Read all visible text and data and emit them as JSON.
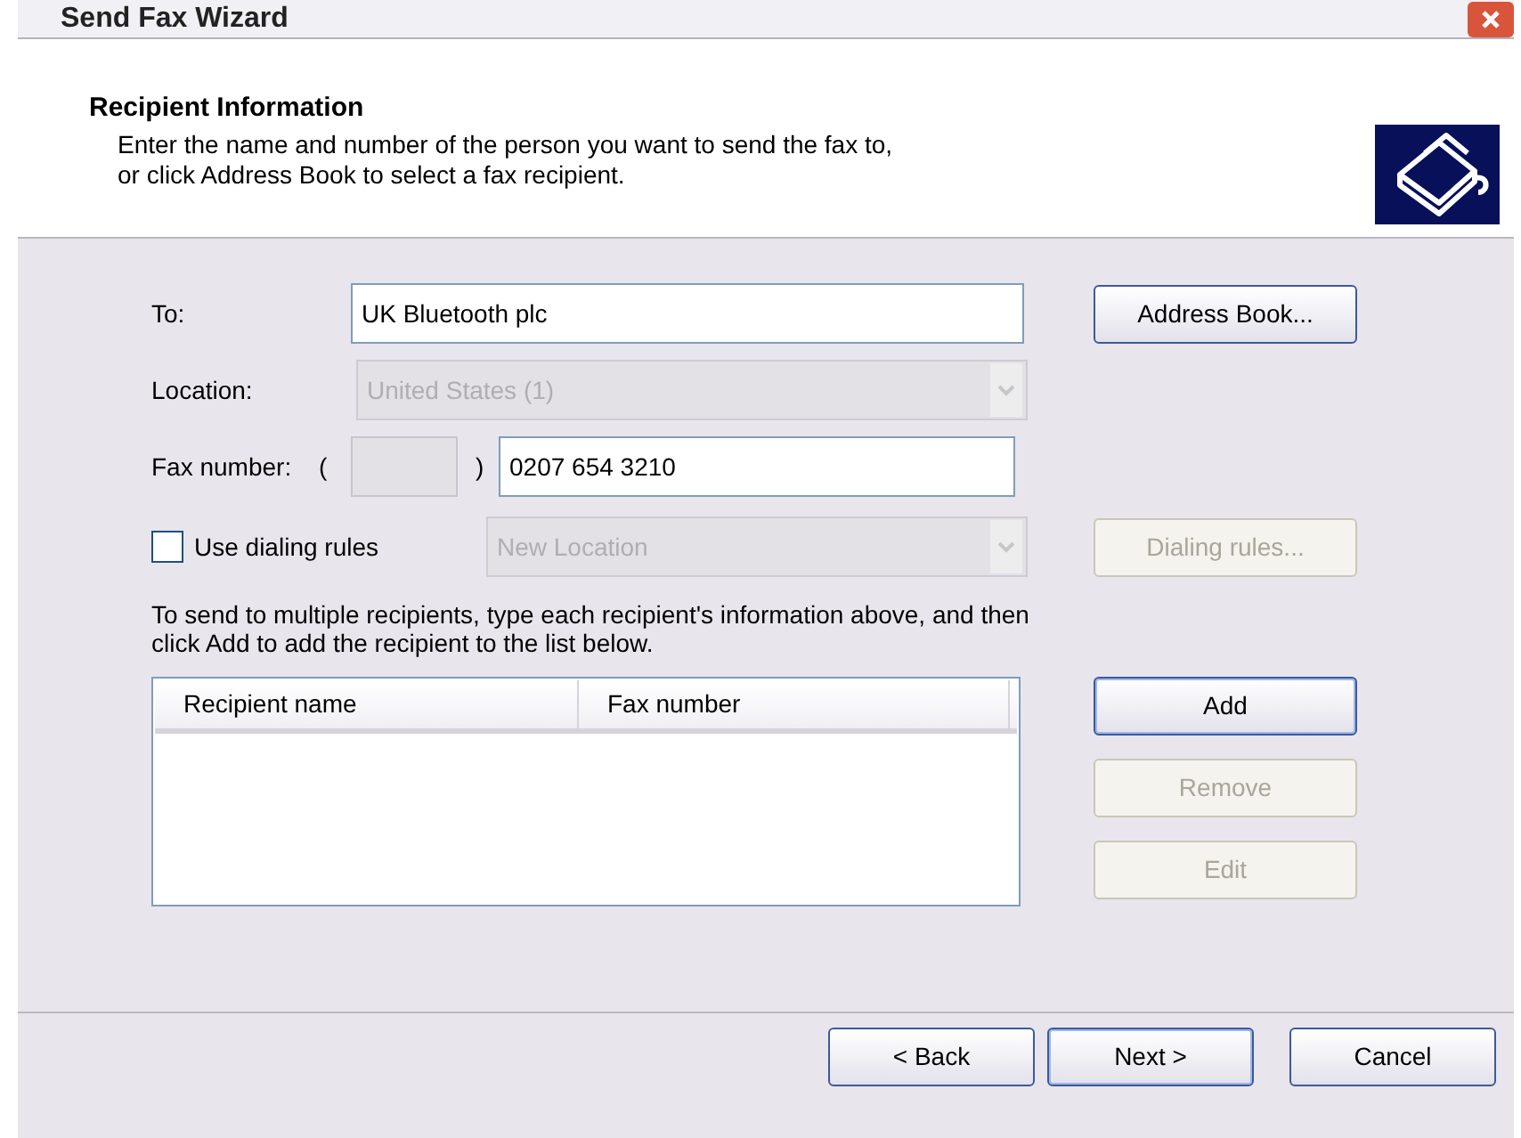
{
  "window": {
    "title": "Send Fax Wizard"
  },
  "header": {
    "title": "Recipient Information",
    "lines": [
      "Enter the name and number of the person you want to send the fax to,",
      "or click Address Book to select a fax recipient."
    ]
  },
  "to": {
    "label": "To:",
    "value": "UK Bluetooth plc"
  },
  "address_book_button": {
    "label": "Address Book...",
    "disabled": false
  },
  "location": {
    "label": "Location:",
    "value": "United States (1)",
    "disabled": true
  },
  "fax_number": {
    "label": "Fax number:",
    "open_paren": "(",
    "close_paren": ")",
    "number": "0207 654 3210",
    "area_disabled": true
  },
  "dialing_rules": {
    "label": "Use dialing rules",
    "checked": false,
    "location": "New Location",
    "location_disabled": true,
    "button": {
      "label": "Dialing rules...",
      "disabled": true
    }
  },
  "help_lines": [
    "To send to multiple recipients, type each recipient's information above, and then",
    "click Add to add the recipient to the list below."
  ],
  "recipients": {
    "columns": [
      "Recipient name",
      "Fax number"
    ]
  },
  "list_buttons": [
    {
      "label": "Add",
      "disabled": false,
      "default": true
    },
    {
      "label": "Remove",
      "disabled": true,
      "default": false
    },
    {
      "label": "Edit",
      "disabled": true,
      "default": false
    }
  ],
  "nav_buttons": [
    {
      "label": "< Back",
      "disabled": false,
      "default": false
    },
    {
      "label": "Next >",
      "disabled": false,
      "default": true
    },
    {
      "label": "Cancel",
      "disabled": false,
      "default": false
    }
  ]
}
